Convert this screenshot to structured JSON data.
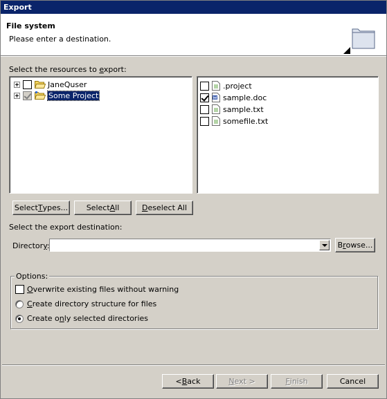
{
  "window": {
    "title": "Export"
  },
  "banner": {
    "title": "File system",
    "description": "Please enter a destination.",
    "icon": "folder-icon"
  },
  "resources": {
    "label_pre": "Select the resources to ",
    "label_key": "e",
    "label_post": "xport:",
    "tree": [
      {
        "label": "JaneQuser",
        "checked": false,
        "icon": "open-folder-icon"
      },
      {
        "label": "Some Project",
        "checked": true,
        "grayed": true,
        "selected": true,
        "icon": "project-folder-icon"
      }
    ],
    "files": [
      {
        "label": ".project",
        "checked": false,
        "icon": "text-file-icon"
      },
      {
        "label": "sample.doc",
        "checked": true,
        "icon": "word-doc-icon"
      },
      {
        "label": "sample.txt",
        "checked": false,
        "icon": "text-file-icon"
      },
      {
        "label": "somefile.txt",
        "checked": false,
        "icon": "text-file-icon"
      }
    ]
  },
  "selection_buttons": {
    "select_types_pre": "Select ",
    "select_types_key": "T",
    "select_types_post": "ypes...",
    "select_all_pre": "Select ",
    "select_all_key": "A",
    "select_all_post": "ll",
    "deselect_all_pre": "",
    "deselect_all_key": "D",
    "deselect_all_post": "eselect All"
  },
  "destination": {
    "label": "Select the export destination:",
    "directory_label_pre": "Director",
    "directory_label_key": "y",
    "directory_label_post": ":",
    "directory_value": "",
    "browse_pre": "B",
    "browse_key": "r",
    "browse_post": "owse..."
  },
  "options": {
    "legend": "Options:",
    "overwrite_pre": "",
    "overwrite_key": "O",
    "overwrite_post": "verwrite existing files without warning",
    "overwrite_checked": false,
    "create_structure_pre": "",
    "create_structure_key": "C",
    "create_structure_post": "reate directory structure for files",
    "create_only_pre": "Create o",
    "create_only_key": "n",
    "create_only_post": "ly selected directories",
    "selected_option": "create_only"
  },
  "footer": {
    "back_pre": "< ",
    "back_key": "B",
    "back_post": "ack",
    "next_pre": "",
    "next_key": "N",
    "next_post": "ext >",
    "finish_pre": "",
    "finish_key": "F",
    "finish_post": "inish",
    "cancel": "Cancel"
  }
}
